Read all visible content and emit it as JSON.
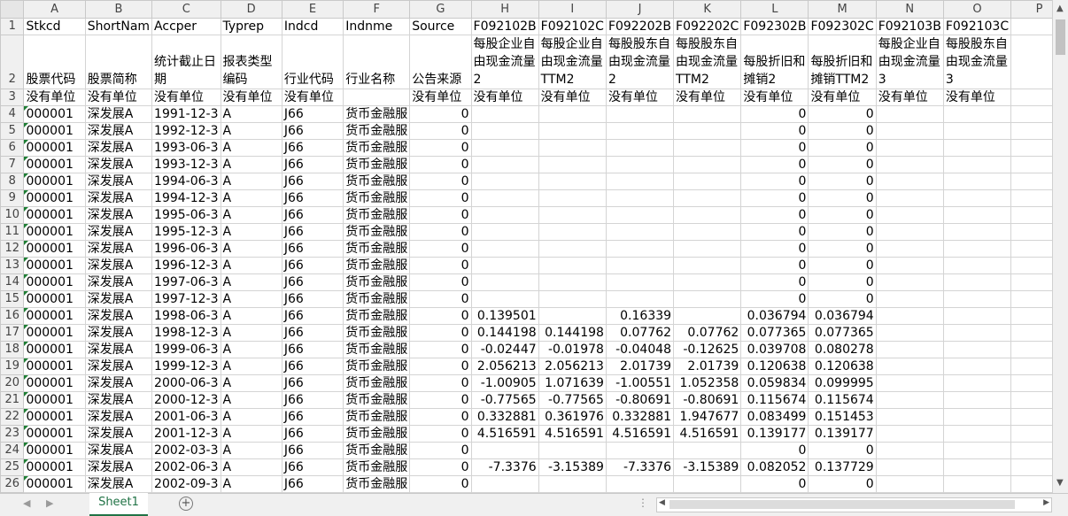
{
  "columns": [
    "A",
    "B",
    "C",
    "D",
    "E",
    "F",
    "G",
    "H",
    "I",
    "J",
    "K",
    "L",
    "M",
    "N",
    "O",
    "P"
  ],
  "header_row1": [
    "Stkcd",
    "ShortNam",
    "Accper",
    "Typrep",
    "Indcd",
    "Indnme",
    "Source",
    "F092102B",
    "F092102C",
    "F092202B",
    "F092202C",
    "F092302B",
    "F092302C",
    "F092103B",
    "F092103C",
    ""
  ],
  "header_row2": [
    "股票代码",
    "股票简称",
    "统计截止日期",
    "报表类型编码",
    "行业代码",
    "行业名称",
    "公告来源",
    "每股企业自由现金流量2",
    "每股企业自由现金流量TTM2",
    "每股股东自由现金流量2",
    "每股股东自由现金流量TTM2",
    "每股折旧和摊销2",
    "每股折旧和摊销TTM2",
    "每股企业自由现金流量3",
    "每股股东自由现金流量3",
    ""
  ],
  "header_row3": [
    "没有单位",
    "没有单位",
    "没有单位",
    "没有单位",
    "没有单位",
    "",
    "没有单位",
    "没有单位",
    "没有单位",
    "没有单位",
    "没有单位",
    "没有单位",
    "没有单位",
    "没有单位",
    "没有单位",
    ""
  ],
  "rows": [
    {
      "n": "4",
      "c": [
        "000001",
        "深发展A",
        "1991-12-3",
        "A",
        "J66",
        "货币金融服",
        "0",
        "",
        "",
        "",
        "",
        "0",
        "0",
        "",
        ""
      ]
    },
    {
      "n": "5",
      "c": [
        "000001",
        "深发展A",
        "1992-12-3",
        "A",
        "J66",
        "货币金融服",
        "0",
        "",
        "",
        "",
        "",
        "0",
        "0",
        "",
        ""
      ]
    },
    {
      "n": "6",
      "c": [
        "000001",
        "深发展A",
        "1993-06-3",
        "A",
        "J66",
        "货币金融服",
        "0",
        "",
        "",
        "",
        "",
        "0",
        "0",
        "",
        ""
      ]
    },
    {
      "n": "7",
      "c": [
        "000001",
        "深发展A",
        "1993-12-3",
        "A",
        "J66",
        "货币金融服",
        "0",
        "",
        "",
        "",
        "",
        "0",
        "0",
        "",
        ""
      ]
    },
    {
      "n": "8",
      "c": [
        "000001",
        "深发展A",
        "1994-06-3",
        "A",
        "J66",
        "货币金融服",
        "0",
        "",
        "",
        "",
        "",
        "0",
        "0",
        "",
        ""
      ]
    },
    {
      "n": "9",
      "c": [
        "000001",
        "深发展A",
        "1994-12-3",
        "A",
        "J66",
        "货币金融服",
        "0",
        "",
        "",
        "",
        "",
        "0",
        "0",
        "",
        ""
      ]
    },
    {
      "n": "10",
      "c": [
        "000001",
        "深发展A",
        "1995-06-3",
        "A",
        "J66",
        "货币金融服",
        "0",
        "",
        "",
        "",
        "",
        "0",
        "0",
        "",
        ""
      ]
    },
    {
      "n": "11",
      "c": [
        "000001",
        "深发展A",
        "1995-12-3",
        "A",
        "J66",
        "货币金融服",
        "0",
        "",
        "",
        "",
        "",
        "0",
        "0",
        "",
        ""
      ]
    },
    {
      "n": "12",
      "c": [
        "000001",
        "深发展A",
        "1996-06-3",
        "A",
        "J66",
        "货币金融服",
        "0",
        "",
        "",
        "",
        "",
        "0",
        "0",
        "",
        ""
      ]
    },
    {
      "n": "13",
      "c": [
        "000001",
        "深发展A",
        "1996-12-3",
        "A",
        "J66",
        "货币金融服",
        "0",
        "",
        "",
        "",
        "",
        "0",
        "0",
        "",
        ""
      ]
    },
    {
      "n": "14",
      "c": [
        "000001",
        "深发展A",
        "1997-06-3",
        "A",
        "J66",
        "货币金融服",
        "0",
        "",
        "",
        "",
        "",
        "0",
        "0",
        "",
        ""
      ]
    },
    {
      "n": "15",
      "c": [
        "000001",
        "深发展A",
        "1997-12-3",
        "A",
        "J66",
        "货币金融服",
        "0",
        "",
        "",
        "",
        "",
        "0",
        "0",
        "",
        ""
      ]
    },
    {
      "n": "16",
      "c": [
        "000001",
        "深发展A",
        "1998-06-3",
        "A",
        "J66",
        "货币金融服",
        "0",
        "0.139501",
        "",
        "0.16339",
        "",
        "0.036794",
        "0.036794",
        "",
        ""
      ]
    },
    {
      "n": "17",
      "c": [
        "000001",
        "深发展A",
        "1998-12-3",
        "A",
        "J66",
        "货币金融服",
        "0",
        "0.144198",
        "0.144198",
        "0.07762",
        "0.07762",
        "0.077365",
        "0.077365",
        "",
        ""
      ]
    },
    {
      "n": "18",
      "c": [
        "000001",
        "深发展A",
        "1999-06-3",
        "A",
        "J66",
        "货币金融服",
        "0",
        "-0.02447",
        "-0.01978",
        "-0.04048",
        "-0.12625",
        "0.039708",
        "0.080278",
        "",
        ""
      ]
    },
    {
      "n": "19",
      "c": [
        "000001",
        "深发展A",
        "1999-12-3",
        "A",
        "J66",
        "货币金融服",
        "0",
        "2.056213",
        "2.056213",
        "2.01739",
        "2.01739",
        "0.120638",
        "0.120638",
        "",
        ""
      ]
    },
    {
      "n": "20",
      "c": [
        "000001",
        "深发展A",
        "2000-06-3",
        "A",
        "J66",
        "货币金融服",
        "0",
        "-1.00905",
        "1.071639",
        "-1.00551",
        "1.052358",
        "0.059834",
        "0.099995",
        "",
        ""
      ]
    },
    {
      "n": "21",
      "c": [
        "000001",
        "深发展A",
        "2000-12-3",
        "A",
        "J66",
        "货币金融服",
        "0",
        "-0.77565",
        "-0.77565",
        "-0.80691",
        "-0.80691",
        "0.115674",
        "0.115674",
        "",
        ""
      ]
    },
    {
      "n": "22",
      "c": [
        "000001",
        "深发展A",
        "2001-06-3",
        "A",
        "J66",
        "货币金融服",
        "0",
        "0.332881",
        "0.361976",
        "0.332881",
        "1.947677",
        "0.083499",
        "0.151453",
        "",
        ""
      ]
    },
    {
      "n": "23",
      "c": [
        "000001",
        "深发展A",
        "2001-12-3",
        "A",
        "J66",
        "货币金融服",
        "0",
        "4.516591",
        "4.516591",
        "4.516591",
        "4.516591",
        "0.139177",
        "0.139177",
        "",
        ""
      ]
    },
    {
      "n": "24",
      "c": [
        "000001",
        "深发展A",
        "2002-03-3",
        "A",
        "J66",
        "货币金融服",
        "0",
        "",
        "",
        "",
        "",
        "0",
        "0",
        "",
        ""
      ]
    },
    {
      "n": "25",
      "c": [
        "000001",
        "深发展A",
        "2002-06-3",
        "A",
        "J66",
        "货币金融服",
        "0",
        "-7.3376",
        "-3.15389",
        "-7.3376",
        "-3.15389",
        "0.082052",
        "0.137729",
        "",
        ""
      ]
    },
    {
      "n": "26",
      "c": [
        "000001",
        "深发展A",
        "2002-09-3",
        "A",
        "J66",
        "货币金融服",
        "0",
        "",
        "",
        "",
        "",
        "0",
        "0",
        "",
        ""
      ]
    }
  ],
  "sheet_tab": "Sheet1"
}
